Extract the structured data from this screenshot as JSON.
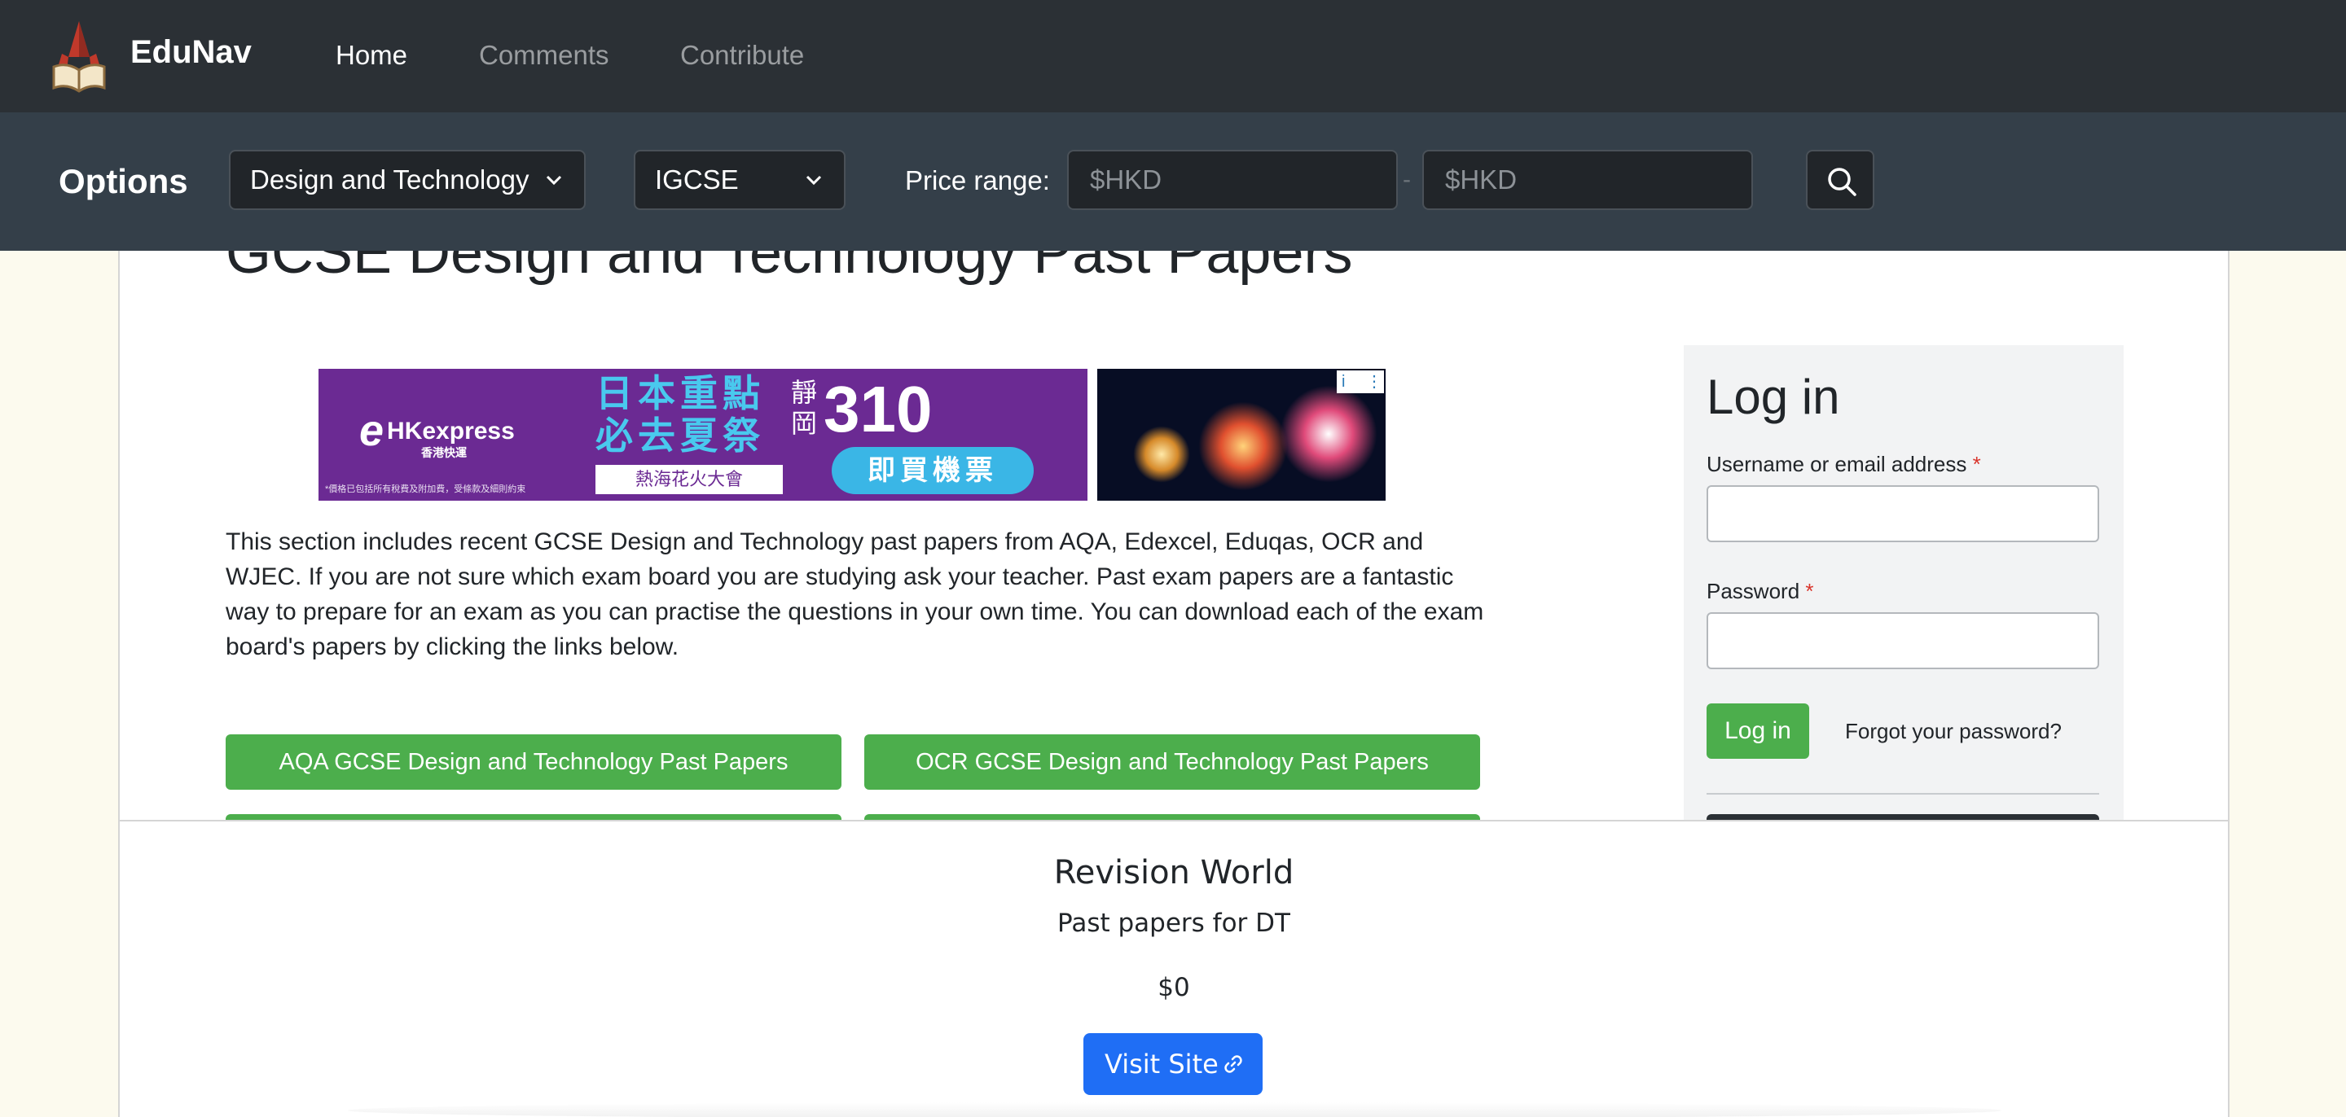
{
  "navbar": {
    "brand": "EduNav",
    "links": [
      {
        "label": "Home",
        "active": true
      },
      {
        "label": "Comments",
        "active": false
      },
      {
        "label": "Contribute",
        "active": false
      }
    ]
  },
  "options": {
    "title": "Options",
    "subject_select": "Design and Technology",
    "level_select": "IGCSE",
    "price_label": "Price range:",
    "price_min_placeholder": "$HKD",
    "price_max_placeholder": "$HKD",
    "price_separator": "-"
  },
  "main": {
    "page_title": "GCSE Design and Technology Past Papers",
    "intro": "This section includes recent GCSE Design and Technology past papers from AQA, Edexcel, Eduqas, OCR and WJEC. If you are not sure which exam board you are studying ask your teacher. Past exam papers are a fantastic way to prepare for an exam as you can practise the questions in your own time. You can download each of the exam board's papers by clicking the links below.",
    "paper_buttons": [
      "AQA GCSE Design and Technology Past Papers",
      "OCR GCSE Design and Technology Past Papers"
    ]
  },
  "ad": {
    "brand_mark": "e",
    "brand_name": "HKexpress",
    "brand_sub": "香港快運",
    "headline_1": "日本重點",
    "headline_2": "必去夏祭",
    "sub": "熱海花火大會",
    "price_prefix": "靜岡",
    "price": "310",
    "cta": "即買機票",
    "fine_print": "*價格已包括所有稅費及附加費，受條款及細則約束",
    "choices_info": "i",
    "choices_menu": "⋮"
  },
  "login": {
    "title": "Log in",
    "username_label": "Username or email address",
    "password_label": "Password",
    "required_mark": "*",
    "submit_label": "Log in",
    "forgot_label": "Forgot your password?"
  },
  "site_card": {
    "name": "Revision World",
    "description": "Past papers for DT",
    "price": "$0",
    "visit_label": "Visit Site"
  },
  "colors": {
    "navbar_bg": "#2b3035",
    "options_bg": "#343f49",
    "page_bg": "#fcfaee",
    "green": "#4cae4c",
    "primary_blue": "#1f6ef5",
    "required_red": "#d9342b"
  },
  "icons": {
    "brand": "rocket-book-logo-icon",
    "dropdown": "chevron-down-icon",
    "search": "search-icon",
    "external_link": "link-icon"
  }
}
